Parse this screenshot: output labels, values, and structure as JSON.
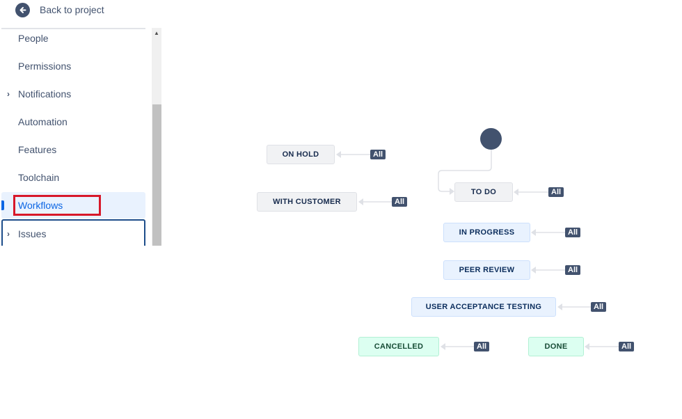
{
  "sidebar": {
    "back_label": "Back to project",
    "items": [
      {
        "label": "People"
      },
      {
        "label": "Permissions"
      },
      {
        "label": "Notifications",
        "expandable": true
      },
      {
        "label": "Automation"
      },
      {
        "label": "Features"
      },
      {
        "label": "Toolchain"
      },
      {
        "label": "Workflows",
        "active": true
      },
      {
        "label": "Issues",
        "expandable": true
      }
    ]
  },
  "workflow": {
    "statuses": [
      {
        "label": "ON HOLD",
        "category": "todo",
        "transition": "All"
      },
      {
        "label": "WITH CUSTOMER",
        "category": "todo",
        "transition": "All"
      },
      {
        "label": "TO DO",
        "category": "todo",
        "transition": "All",
        "initial": true
      },
      {
        "label": "IN PROGRESS",
        "category": "in-progress",
        "transition": "All"
      },
      {
        "label": "PEER REVIEW",
        "category": "in-progress",
        "transition": "All"
      },
      {
        "label": "USER ACCEPTANCE TESTING",
        "category": "in-progress",
        "transition": "All"
      },
      {
        "label": "CANCELLED",
        "category": "done",
        "transition": "All"
      },
      {
        "label": "DONE",
        "category": "done",
        "transition": "All"
      }
    ]
  }
}
